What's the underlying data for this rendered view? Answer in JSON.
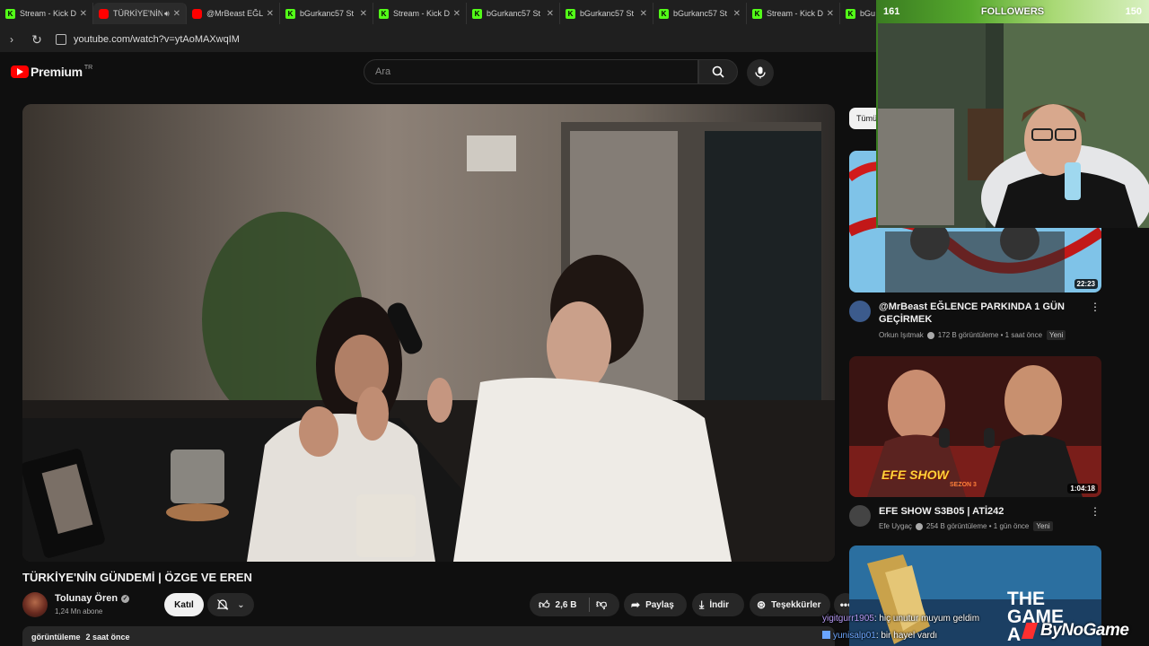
{
  "browser": {
    "tabs": [
      {
        "title": "Stream - Kick D",
        "icon": "kick",
        "active": false
      },
      {
        "title": "TÜRKİYE'NİN",
        "icon": "youtube",
        "active": true,
        "audio": true
      },
      {
        "title": "@MrBeast EĞL",
        "icon": "youtube",
        "active": false
      },
      {
        "title": "bGurkanc57 St",
        "icon": "kick",
        "active": false
      },
      {
        "title": "Stream - Kick D",
        "icon": "kick",
        "active": false
      },
      {
        "title": "bGurkanc57 St",
        "icon": "kick",
        "active": false
      },
      {
        "title": "bGurkanc57 St",
        "icon": "kick",
        "active": false
      },
      {
        "title": "bGurkanc57 St",
        "icon": "kick",
        "active": false
      },
      {
        "title": "Stream - Kick D",
        "icon": "kick",
        "active": false
      },
      {
        "title": "bGu",
        "icon": "kick",
        "active": false
      }
    ],
    "url": "youtube.com/watch?v=ytAoMAXwqIM"
  },
  "youtube": {
    "logo_text": "Premium",
    "region": "TR",
    "search_placeholder": "Ara"
  },
  "video": {
    "title": "TÜRKİYE'NİN GÜNDEMİ | ÖZGE VE EREN",
    "channel": "Tolunay Ören",
    "subscribers": "1,24 Mn abone",
    "join_label": "Katıl",
    "likes": "2,6 B",
    "share_label": "Paylaş",
    "download_label": "İndir",
    "thanks_label": "Teşekkürler",
    "views_label": "görüntüleme",
    "posted": "2 saat önce"
  },
  "sidebar": {
    "chip_label": "Tümü",
    "recommendations": [
      {
        "title": "@MrBeast  EĞLENCE PARKINDA 1 GÜN GEÇİRMEK",
        "channel": "Orkun Işıtmak",
        "views": "172 B görüntüleme",
        "age": "1 saat önce",
        "badge": "Yeni",
        "duration": "22:23"
      },
      {
        "title": "EFE SHOW S3B05 | ATİ242",
        "channel": "Efe Uygaç",
        "views": "254 B görüntüleme",
        "age": "1 gün önce",
        "badge": "Yeni",
        "duration": "1:04:18",
        "thumb_text": "EFE SHOW",
        "thumb_subtext": "SEZON 3"
      },
      {
        "thumb_text": "THE GAME A"
      }
    ]
  },
  "overlay": {
    "followers_label": "FOLLOWERS",
    "followers_current": "161",
    "followers_goal": "150",
    "chat": [
      {
        "user": "yigitgurr1905",
        "message": ": hiç unutur muyum geldim"
      },
      {
        "user": "yunisalp01",
        "message": ": bir hayel vardı"
      }
    ],
    "sponsor": "ByNoGame"
  },
  "colors": {
    "background": "#0f0f0f",
    "youtube_red": "#ff0000",
    "kick_green": "#53fc18",
    "followers_bar": "#56a92d"
  }
}
